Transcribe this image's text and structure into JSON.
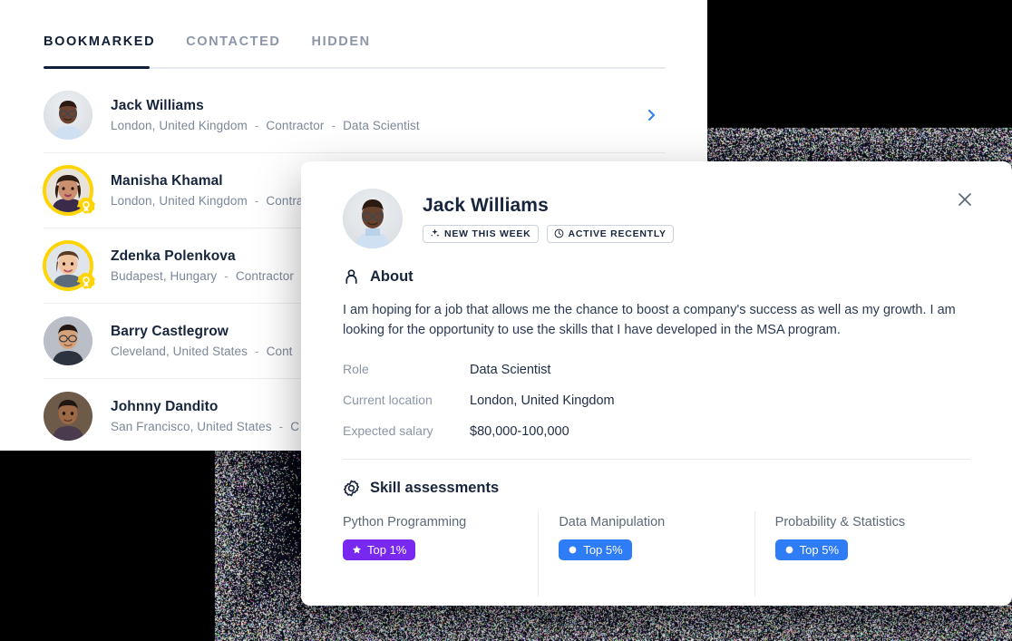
{
  "colors": {
    "accent_blue": "#2f7df6",
    "pill_purple": "#7928f0",
    "pill_blue": "#2f7df6",
    "badge_yellow": "#ffd400",
    "text_dark": "#16243c",
    "text_muted": "#7c8798",
    "background": "#000000"
  },
  "list_panel": {
    "tabs": [
      {
        "label": "BOOKMARKED",
        "active": true
      },
      {
        "label": "CONTACTED",
        "active": false
      },
      {
        "label": "HIDDEN",
        "active": false
      }
    ],
    "people": [
      {
        "name": "Jack Williams",
        "location": "London, United Kingdom",
        "employment": "Contractor",
        "role": "Data Scientist",
        "verified": false,
        "chevron": true,
        "avatar": "jack"
      },
      {
        "name": "Manisha Khamal",
        "location": "London, United Kingdom",
        "employment": "Contractor",
        "role": "",
        "verified": true,
        "chevron": false,
        "avatar": "manisha"
      },
      {
        "name": "Zdenka Polenkova",
        "location": "Budapest, Hungary",
        "employment": "Contractor",
        "role": "",
        "verified": true,
        "chevron": false,
        "avatar": "zdenka"
      },
      {
        "name": "Barry Castlegrow",
        "location": "Cleveland, United States",
        "employment": "Cont",
        "role": "",
        "verified": false,
        "chevron": false,
        "avatar": "barry"
      },
      {
        "name": "Johnny Dandito",
        "location": "San Francisco, United States",
        "employment": "C",
        "role": "",
        "verified": false,
        "chevron": false,
        "avatar": "johnny"
      }
    ],
    "separator": "-"
  },
  "detail_modal": {
    "name": "Jack Williams",
    "close_label": "×",
    "tags": [
      {
        "label": "NEW THIS WEEK",
        "icon": "sparkle-icon"
      },
      {
        "label": "ACTIVE RECENTLY",
        "icon": "clock-icon"
      }
    ],
    "about": {
      "title": "About",
      "icon": "person-icon",
      "body": "I am hoping for a job that allows me the chance to boost a company's success as well as my growth. I am looking for the opportunity to use the skills that I have developed in the MSA program."
    },
    "details": [
      {
        "label": "Role",
        "value": "Data Scientist"
      },
      {
        "label": "Current location",
        "value": "London, United Kingdom"
      },
      {
        "label": "Expected salary",
        "value": "$80,000-100,000"
      }
    ],
    "skills_section": {
      "title": "Skill assessments",
      "icon": "gear-icon",
      "skills": [
        {
          "name": "Python Programming",
          "rank": "Top 1%",
          "rank_icon": "star-icon",
          "color": "#7928f0"
        },
        {
          "name": "Data Manipulation",
          "rank": "Top 5%",
          "rank_icon": "circle-icon",
          "color": "#2f7df6"
        },
        {
          "name": "Probability & Statistics",
          "rank": "Top 5%",
          "rank_icon": "circle-icon",
          "color": "#2f7df6"
        }
      ]
    }
  }
}
